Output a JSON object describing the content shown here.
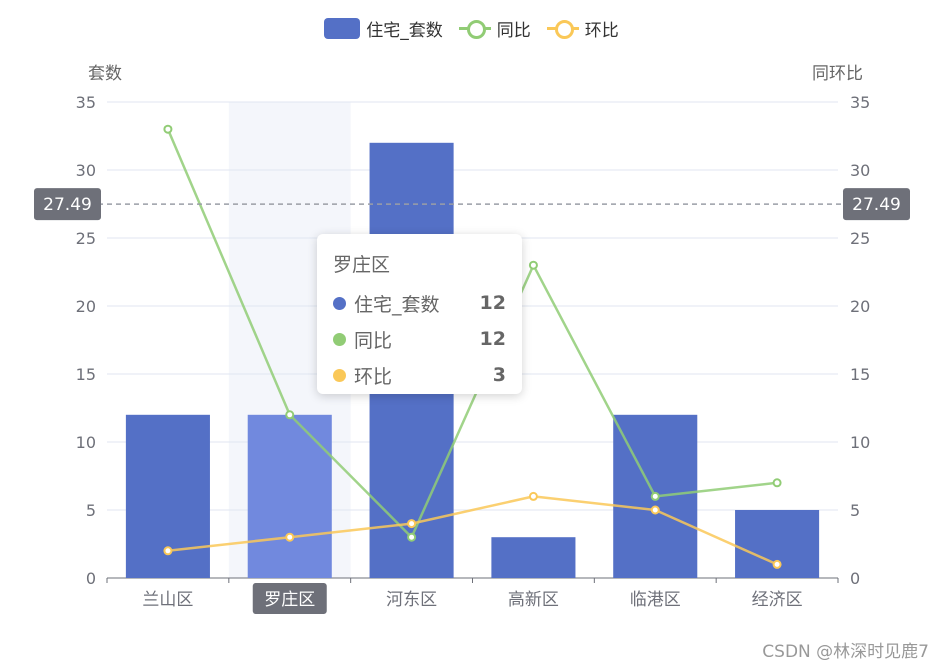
{
  "legend": {
    "items": [
      {
        "label": "住宅_套数",
        "type": "bar",
        "color": "#5470c6"
      },
      {
        "label": "同比",
        "type": "line",
        "color": "#91cc75"
      },
      {
        "label": "环比",
        "type": "line",
        "color": "#fac858"
      }
    ]
  },
  "axes": {
    "left_name": "套数",
    "right_name": "同环比"
  },
  "tooltip": {
    "title": "罗庄区",
    "rows": [
      {
        "name": "住宅_套数",
        "value": "12",
        "color": "#5470c6"
      },
      {
        "name": "同比",
        "value": "12",
        "color": "#91cc75"
      },
      {
        "name": "环比",
        "value": "3",
        "color": "#fac858"
      }
    ]
  },
  "watermark": "CSDN @林深时见鹿7",
  "chart_data": {
    "type": "bar",
    "categories": [
      "兰山区",
      "罗庄区",
      "河东区",
      "高新区",
      "临港区",
      "经济区"
    ],
    "series": [
      {
        "name": "住宅_套数",
        "type": "bar",
        "values": [
          12,
          12,
          32,
          3,
          12,
          5
        ],
        "color": "#5470c6"
      },
      {
        "name": "同比",
        "type": "line",
        "values": [
          33,
          12,
          3,
          23,
          6,
          7
        ],
        "color": "#91cc75"
      },
      {
        "name": "环比",
        "type": "line",
        "values": [
          2,
          3,
          4,
          6,
          5,
          1
        ],
        "color": "#fac858"
      }
    ],
    "ylim": [
      0,
      35
    ],
    "yticks": [
      0,
      5,
      10,
      15,
      20,
      25,
      30,
      35
    ],
    "y2lim": [
      0,
      35
    ],
    "y2ticks": [
      0,
      5,
      10,
      15,
      20,
      25,
      30,
      35
    ],
    "ylabel": "套数",
    "y2label": "同环比",
    "markline": {
      "value": 27.49,
      "label": "27.49"
    },
    "highlighted_category": "罗庄区",
    "grid": true,
    "legend_position": "top-center"
  }
}
